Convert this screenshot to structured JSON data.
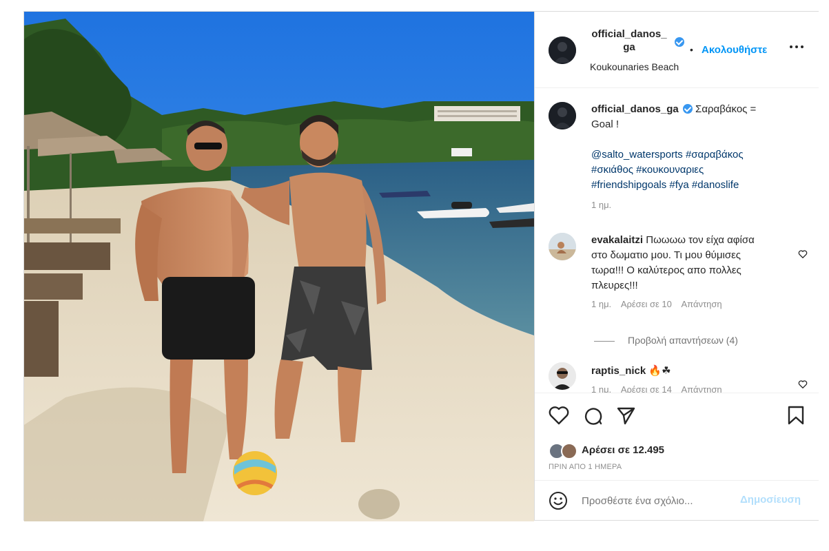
{
  "header": {
    "username_line1": "official_danos_",
    "username_line2": "ga",
    "location": "Koukounaries Beach",
    "dot": "•",
    "follow_label": "Ακολουθήστε",
    "more_icon": "more-horizontal-icon"
  },
  "caption": {
    "username": "official_danos_ga",
    "text_line1": "Σαραβάκος =",
    "text_line2": "Goal !",
    "tags_line1": "@salto_watersports #σαραβάκος",
    "tags_line2": "#σκιάθος #κουκουναριες",
    "tags_line3": "#friendshipgoals #fya #danoslife",
    "time": "1 ημ."
  },
  "comments": [
    {
      "username": "evakalaitzi",
      "text_line1": "Πωωωω τον είχα αφίσα",
      "text_line2": "στο δωματιο μου. Τι μου θύμισες",
      "text_line3": "τωρα!!! Ο καλύτερος απο πολλες",
      "text_line4": "πλευρες!!!",
      "time": "1 ημ.",
      "likes": "Αρέσει σε 10",
      "reply": "Απάντηση",
      "view_replies": "Προβολή απαντήσεων (4)"
    },
    {
      "username": "raptis_nick",
      "emoji": "🔥☘",
      "time": "1 ημ.",
      "likes": "Αρέσει σε 14",
      "reply": "Απάντηση"
    }
  ],
  "actions": {
    "likes": "Αρέσει σε 12.495",
    "posted": "ΠΡΙΝ ΑΠΟ 1 ΗΜΕΡΑ"
  },
  "add_comment": {
    "placeholder": "Προσθέστε ένα σχόλιο...",
    "post_label": "Δημοσίευση"
  },
  "colors": {
    "accent": "#0095f6",
    "verified": "#3897f0",
    "post_disabled": "#b2dffc",
    "text": "#262626",
    "muted": "#8e8e8e"
  }
}
